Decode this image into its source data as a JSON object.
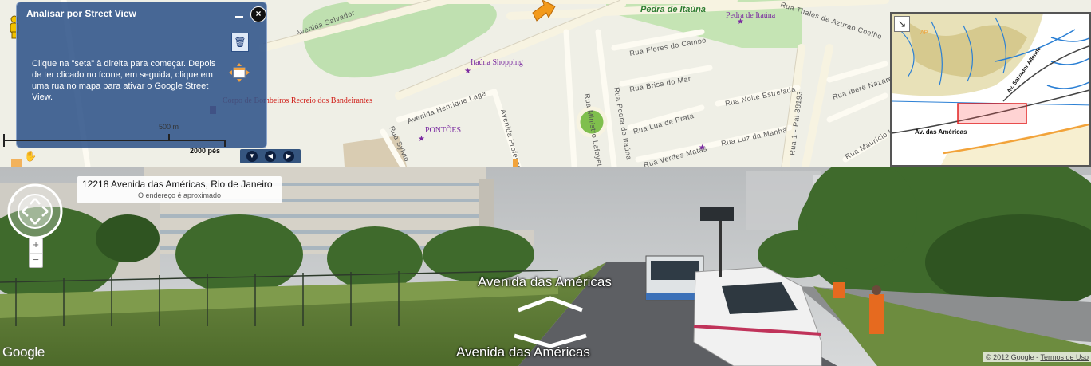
{
  "map": {
    "streets": {
      "avenida_salvador": "Avenida Salvador",
      "rua_flores_do_campo": "Rua Flores do Campo",
      "rua_brisa_do_mar": "Rua Brisa do Mar",
      "rua_pedra_de_itauna": "Rua Pedra de Itaúna",
      "rua_lua_de_prata": "Rua Lua de Prata",
      "rua_luz_da_manha": "Rua Luz da Manhã",
      "rua_verdes_matas": "Rua Verdes Matas",
      "rua_noite_estrelada": "Rua Noite Estrelada",
      "rua_ibere_nazareth": "Rua Iberê Nazareth",
      "rua_mauricio_lacerda": "Rua Maurício Lacerda",
      "rua_thales_de_azurao": "Rua Thales de Azurao Coelho",
      "rua_ministro_lafayette": "Rua Ministro Lafayette",
      "rua_1_pal": "Rua 1 - Pal 38193",
      "avenida_henrique_lage": "Avenida Henrique Lage",
      "avenida_professor": "Avenida Professor",
      "rua_sylvio": "Rua Sylvio"
    },
    "pois": {
      "pedra_itauna_park": "Pedra de Itaúna",
      "pedra_itauna_poi": "Pedra de Itaúna",
      "itauna_shopping": "Itaúna Shopping",
      "corpo_bombeiros": "Corpo de Bombeiros Recreio dos Bandeirantes",
      "pontoes": "PONTÕES"
    },
    "scale": {
      "meters": "500 m",
      "feet": "2000 pés"
    }
  },
  "sv_panel": {
    "title": "Analisar por Street View",
    "close_glyph": "×",
    "instructions": "Clique na \"seta\" à direita para começar. Depois de ter clicado no ícone, em seguida, clique em uma rua no mapa para ativar o Google Street View."
  },
  "overview_map": {
    "label_av_americas": "Av. das Américas",
    "label_av_salvador": "Av. Salvador Allende",
    "label_ap": "AP"
  },
  "street_view": {
    "address": "12218 Avenida das Américas, Rio de Janeiro",
    "address_note": "O endereço é aproximado",
    "road_label_top": "Avenida das Américas",
    "road_label_bottom": "Avenida das Américas",
    "zoom_in": "+",
    "zoom_out": "−",
    "google": "Google",
    "copyright": "© 2012 Google -",
    "terms": "Termos de Uso"
  },
  "icons": [
    "pegman-icon",
    "minimize-icon",
    "close-icon",
    "trash-icon",
    "move-icon",
    "hand-icon",
    "expand-down-icon",
    "prev-icon",
    "next-icon",
    "overview-toggle-icon",
    "compass-icon",
    "orange-arrow-icon"
  ]
}
